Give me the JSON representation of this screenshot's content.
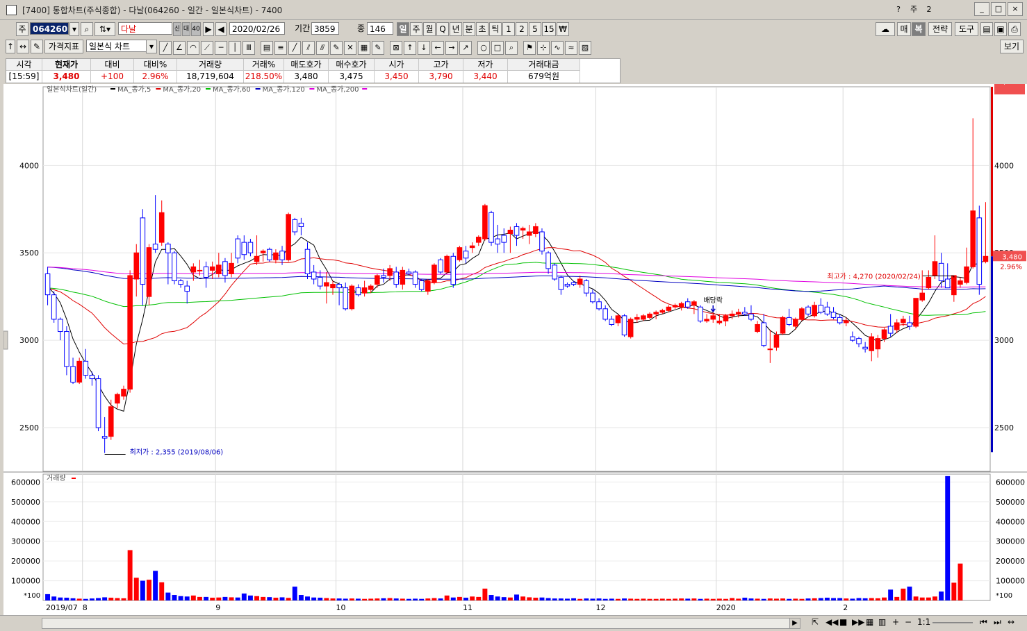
{
  "window": {
    "title": "[7400] 통합차트(주식종합) - 다날(064260 - 일간 - 일본식차트) - 7400",
    "buttons": [
      "_",
      "□",
      "×"
    ],
    "extra_icons": [
      "?",
      "주",
      "2"
    ]
  },
  "toolbar1": {
    "code_prefix": "주",
    "code": "064260",
    "name": "다날",
    "date": "2020/02/26",
    "period_label": "기간",
    "period_value": "3859",
    "count_label": "종",
    "count_value": "146",
    "periods": [
      "일",
      "주",
      "월",
      "Q",
      "년",
      "분",
      "초",
      "틱",
      "1",
      "2",
      "5",
      "15",
      "₩"
    ],
    "right_buttons": [
      "매",
      "복",
      "전략",
      "도구"
    ],
    "mini": [
      "신",
      "대",
      "40"
    ]
  },
  "toolbar2": {
    "indicator_label": "가격지표",
    "chart_type": "일본식 차트",
    "right_button": "보기"
  },
  "quote": {
    "headers": [
      "시각",
      "현재가",
      "대비",
      "대비%",
      "거래량",
      "거래%",
      "매도호가",
      "매수호가",
      "시가",
      "고가",
      "저가",
      "거래대금"
    ],
    "values": [
      "[15:59]",
      "3,480",
      "+100",
      "2.96%",
      "18,719,604",
      "218.50%",
      "3,480",
      "3,475",
      "3,450",
      "3,790",
      "3,440",
      "679억원"
    ]
  },
  "legend": {
    "main": "일본식차트(일간)",
    "items": [
      {
        "label": "MA_종가,5",
        "color": "#000000"
      },
      {
        "label": "MA_종가,20",
        "color": "#e00000"
      },
      {
        "label": "MA_종가,60",
        "color": "#00c000"
      },
      {
        "label": "MA_종가,120",
        "color": "#0000c0"
      },
      {
        "label": "MA_종가,200",
        "color": "#e000e0"
      }
    ],
    "volume": "거래량"
  },
  "annotations": {
    "high": "최고가 : 4,270 (2020/02/24)",
    "low": "최저가 : 2,355 (2019/08/06)",
    "dividend": "배당락",
    "price_tag": "3,480",
    "pct_tag": "2.96%",
    "vol_tag": "18,719K",
    "vol_pct_tag": "218.50%",
    "vol_unit": "*100"
  },
  "bottom": {
    "ratio": "1:1"
  },
  "colors": {
    "up": "#ff0000",
    "down": "#0000ff"
  },
  "chart_data": {
    "type": "candlestick",
    "price_axis": {
      "ticks": [
        2500,
        3000,
        3500,
        4000
      ],
      "tick_labels": [
        "2500",
        "3000",
        "3500",
        "4000"
      ],
      "range": [
        2250,
        4450
      ]
    },
    "volume_axis": {
      "ticks": [
        100000,
        200000,
        300000,
        400000,
        500000,
        600000
      ],
      "tick_labels": [
        "100000",
        "200000",
        "300000",
        "400000",
        "500000",
        "600000"
      ],
      "range": [
        0,
        640000
      ],
      "unit": "*100"
    },
    "x_labels": [
      {
        "label": "2019/07",
        "index": 0
      },
      {
        "label": "8",
        "index": 6
      },
      {
        "label": "9",
        "index": 27
      },
      {
        "label": "10",
        "index": 46
      },
      {
        "label": "11",
        "index": 66
      },
      {
        "label": "12",
        "index": 87
      },
      {
        "label": "2020",
        "index": 106
      },
      {
        "label": "2",
        "index": 126
      }
    ],
    "ohlc": [
      [
        3380,
        3420,
        3200,
        3260
      ],
      [
        3260,
        3280,
        3100,
        3120
      ],
      [
        3120,
        3130,
        3000,
        3050
      ],
      [
        3050,
        3080,
        2800,
        2850
      ],
      [
        2850,
        2900,
        2750,
        2760
      ],
      [
        2760,
        2900,
        2750,
        2880
      ],
      [
        2880,
        2950,
        2780,
        2800
      ],
      [
        2800,
        2820,
        2740,
        2780
      ],
      [
        2780,
        2800,
        2480,
        2500
      ],
      [
        2450,
        2560,
        2355,
        2440
      ],
      [
        2450,
        2660,
        2430,
        2620
      ],
      [
        2640,
        2700,
        2610,
        2690
      ],
      [
        2680,
        2740,
        2660,
        2720
      ],
      [
        2720,
        3400,
        2700,
        3370
      ],
      [
        3350,
        3550,
        3250,
        3500
      ],
      [
        3700,
        3750,
        3200,
        3320
      ],
      [
        3250,
        3550,
        3200,
        3530
      ],
      [
        3550,
        3830,
        3500,
        3520
      ],
      [
        3560,
        3800,
        3540,
        3730
      ],
      [
        3550,
        3560,
        3320,
        3500
      ],
      [
        3500,
        3510,
        3320,
        3340
      ],
      [
        3340,
        3350,
        3300,
        3320
      ],
      [
        3310,
        3340,
        3210,
        3280
      ],
      [
        3390,
        3440,
        3340,
        3420
      ],
      [
        3400,
        3460,
        3370,
        3400
      ],
      [
        3420,
        3450,
        3300,
        3360
      ],
      [
        3400,
        3450,
        3350,
        3420
      ],
      [
        3380,
        3500,
        3360,
        3430
      ],
      [
        3450,
        3470,
        3330,
        3370
      ],
      [
        3380,
        3500,
        3360,
        3440
      ],
      [
        3580,
        3600,
        3440,
        3470
      ],
      [
        3560,
        3600,
        3460,
        3490
      ],
      [
        3560,
        3580,
        3480,
        3500
      ],
      [
        3450,
        3600,
        3430,
        3480
      ],
      [
        3500,
        3520,
        3450,
        3510
      ],
      [
        3520,
        3530,
        3450,
        3460
      ],
      [
        3460,
        3520,
        3440,
        3500
      ],
      [
        3510,
        3540,
        3430,
        3460
      ],
      [
        3460,
        3730,
        3450,
        3720
      ],
      [
        3690,
        3700,
        3600,
        3620
      ],
      [
        3670,
        3700,
        3600,
        3650
      ],
      [
        3520,
        3560,
        3350,
        3380
      ],
      [
        3390,
        3430,
        3320,
        3350
      ],
      [
        3360,
        3400,
        3290,
        3310
      ],
      [
        3310,
        3390,
        3210,
        3330
      ],
      [
        3300,
        3340,
        3260,
        3320
      ],
      [
        3320,
        3330,
        3200,
        3300
      ],
      [
        3300,
        3330,
        3170,
        3180
      ],
      [
        3180,
        3320,
        3170,
        3310
      ],
      [
        3300,
        3320,
        3250,
        3260
      ],
      [
        3270,
        3340,
        3250,
        3300
      ],
      [
        3290,
        3320,
        3270,
        3310
      ],
      [
        3320,
        3380,
        3300,
        3370
      ],
      [
        3370,
        3410,
        3330,
        3360
      ],
      [
        3370,
        3430,
        3340,
        3410
      ],
      [
        3390,
        3420,
        3300,
        3320
      ],
      [
        3320,
        3420,
        3290,
        3400
      ],
      [
        3390,
        3410,
        3370,
        3380
      ],
      [
        3390,
        3400,
        3300,
        3320
      ],
      [
        3340,
        3350,
        3280,
        3290
      ],
      [
        3280,
        3350,
        3260,
        3340
      ],
      [
        3330,
        3440,
        3320,
        3430
      ],
      [
        3460,
        3470,
        3380,
        3390
      ],
      [
        3390,
        3490,
        3380,
        3480
      ],
      [
        3480,
        3500,
        3300,
        3320
      ],
      [
        3460,
        3540,
        3450,
        3530
      ],
      [
        3510,
        3540,
        3440,
        3470
      ],
      [
        3530,
        3560,
        3500,
        3540
      ],
      [
        3560,
        3600,
        3540,
        3590
      ],
      [
        3580,
        3780,
        3570,
        3770
      ],
      [
        3730,
        3740,
        3540,
        3560
      ],
      [
        3580,
        3660,
        3500,
        3550
      ],
      [
        3600,
        3640,
        3500,
        3560
      ],
      [
        3610,
        3650,
        3500,
        3630
      ],
      [
        3650,
        3670,
        3540,
        3600
      ],
      [
        3630,
        3650,
        3580,
        3640
      ],
      [
        3600,
        3660,
        3550,
        3620
      ],
      [
        3610,
        3670,
        3590,
        3650
      ],
      [
        3620,
        3640,
        3490,
        3510
      ],
      [
        3500,
        3510,
        3380,
        3410
      ],
      [
        3430,
        3440,
        3340,
        3350
      ],
      [
        3360,
        3370,
        3260,
        3290
      ],
      [
        3320,
        3330,
        3300,
        3310
      ],
      [
        3330,
        3340,
        3310,
        3320
      ],
      [
        3320,
        3370,
        3300,
        3350
      ],
      [
        3340,
        3350,
        3250,
        3270
      ],
      [
        3270,
        3290,
        3210,
        3220
      ],
      [
        3220,
        3240,
        3170,
        3180
      ],
      [
        3180,
        3200,
        3110,
        3120
      ],
      [
        3120,
        3140,
        3080,
        3090
      ],
      [
        3100,
        3150,
        3080,
        3140
      ],
      [
        3140,
        3150,
        3020,
        3030
      ],
      [
        3020,
        3130,
        3010,
        3120
      ],
      [
        3120,
        3150,
        3100,
        3130
      ],
      [
        3120,
        3150,
        3110,
        3140
      ],
      [
        3130,
        3160,
        3120,
        3150
      ],
      [
        3150,
        3170,
        3120,
        3160
      ],
      [
        3160,
        3180,
        3150,
        3170
      ],
      [
        3170,
        3200,
        3160,
        3190
      ],
      [
        3190,
        3210,
        3180,
        3200
      ],
      [
        3190,
        3220,
        3170,
        3210
      ],
      [
        3220,
        3240,
        3180,
        3190
      ],
      [
        3200,
        3230,
        3150,
        3220
      ],
      [
        3190,
        3200,
        3100,
        3110
      ],
      [
        3110,
        3150,
        3100,
        3120
      ],
      [
        3120,
        3160,
        3100,
        3140
      ],
      [
        3100,
        3150,
        3090,
        3110
      ],
      [
        3110,
        3150,
        3080,
        3140
      ],
      [
        3140,
        3170,
        3120,
        3150
      ],
      [
        3150,
        3180,
        3130,
        3160
      ],
      [
        3160,
        3190,
        3140,
        3150
      ],
      [
        3150,
        3200,
        3110,
        3120
      ],
      [
        3050,
        3110,
        3040,
        3090
      ],
      [
        3100,
        3150,
        2960,
        2970
      ],
      [
        2950,
        3060,
        2870,
        2950
      ],
      [
        2960,
        3050,
        2940,
        3030
      ],
      [
        3040,
        3140,
        3030,
        3130
      ],
      [
        3130,
        3180,
        3080,
        3090
      ],
      [
        3080,
        3130,
        3060,
        3120
      ],
      [
        3120,
        3190,
        3110,
        3180
      ],
      [
        3190,
        3200,
        3140,
        3150
      ],
      [
        3140,
        3220,
        3130,
        3200
      ],
      [
        3200,
        3240,
        3150,
        3160
      ],
      [
        3190,
        3220,
        3140,
        3150
      ],
      [
        3160,
        3190,
        3120,
        3130
      ],
      [
        3130,
        3150,
        3090,
        3100
      ],
      [
        3100,
        3130,
        3080,
        3110
      ],
      [
        3020,
        3050,
        2990,
        3000
      ],
      [
        3010,
        3020,
        2960,
        2980
      ],
      [
        2960,
        2990,
        2930,
        2950
      ],
      [
        2940,
        3040,
        2880,
        3020
      ],
      [
        2950,
        3030,
        2900,
        3010
      ],
      [
        3010,
        3070,
        2990,
        3060
      ],
      [
        3080,
        3150,
        3020,
        3040
      ],
      [
        3060,
        3120,
        3040,
        3100
      ],
      [
        3100,
        3140,
        3080,
        3120
      ],
      [
        3100,
        3140,
        3060,
        3080
      ],
      [
        3080,
        3240,
        3070,
        3240
      ],
      [
        3230,
        3400,
        3220,
        3270
      ],
      [
        3300,
        3400,
        3290,
        3360
      ],
      [
        3370,
        3600,
        3350,
        3450
      ],
      [
        3440,
        3500,
        3300,
        3340
      ],
      [
        3350,
        3440,
        3300,
        3300
      ],
      [
        3260,
        3360,
        3220,
        3370
      ],
      [
        3320,
        3360,
        3300,
        3340
      ],
      [
        3330,
        3530,
        3320,
        3420
      ],
      [
        3420,
        4270,
        3410,
        3740
      ],
      [
        3700,
        3770,
        3260,
        3320
      ],
      [
        3450,
        3790,
        3440,
        3480
      ]
    ],
    "volume": [
      32000,
      20000,
      15000,
      14000,
      11000,
      9000,
      8000,
      10000,
      12000,
      16000,
      14000,
      12000,
      11000,
      255000,
      115000,
      100000,
      105000,
      150000,
      92000,
      40000,
      28000,
      22000,
      20000,
      25000,
      18000,
      18000,
      14000,
      15000,
      18000,
      16000,
      15000,
      35000,
      25000,
      22000,
      18000,
      17000,
      14000,
      16000,
      13000,
      70000,
      28000,
      20000,
      15000,
      14000,
      12000,
      10000,
      10000,
      9000,
      10000,
      9000,
      8000,
      9000,
      10000,
      11000,
      12000,
      10000,
      9000,
      8000,
      9000,
      8000,
      10000,
      12000,
      10000,
      25000,
      15000,
      18000,
      14000,
      20000,
      18000,
      60000,
      28000,
      20000,
      17000,
      15000,
      30000,
      20000,
      16000,
      14000,
      15000,
      12000,
      10000,
      10000,
      9000,
      11000,
      8000,
      10000,
      9000,
      10000,
      8000,
      9000,
      8000,
      10000,
      9000,
      8000,
      9000,
      8000,
      8000,
      9000,
      8000,
      9000,
      10000,
      9000,
      10000,
      8000,
      9000,
      8000,
      9000,
      8000,
      12000,
      9000,
      14000,
      10000,
      9000,
      8000,
      10000,
      9000,
      10000,
      8000,
      9000,
      8000,
      10000,
      11000,
      12000,
      14000,
      12000,
      12000,
      10000,
      9000,
      12000,
      11000,
      12000,
      11000,
      15000,
      55000,
      18000,
      60000,
      70000,
      20000,
      15000,
      15000,
      20000,
      45000,
      630000,
      90000,
      187000
    ]
  }
}
